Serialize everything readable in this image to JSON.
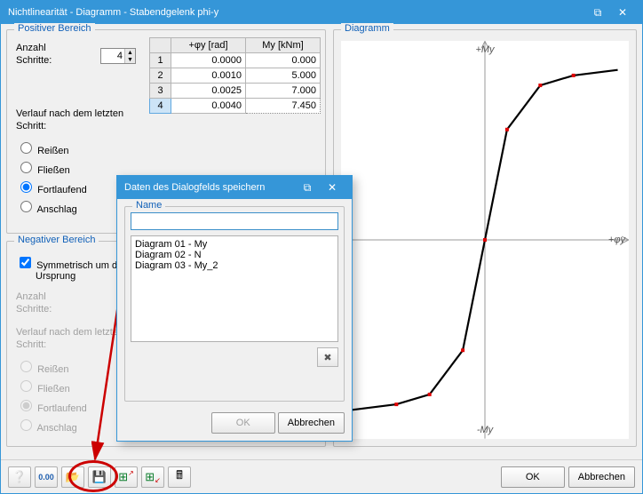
{
  "window_title": "Nichtlinearität - Diagramm - Stabendgelenk phi-y",
  "groups": {
    "positive": "Positiver Bereich",
    "negative": "Negativer Bereich",
    "diagram": "Diagramm"
  },
  "labels": {
    "anzahl": "Anzahl",
    "schritte": "Schritte:",
    "verlauf1": "Verlauf nach dem letzten",
    "verlauf2": "Schritt:",
    "sym": "Symmetrisch um den",
    "sym2": "Ursprung"
  },
  "steps_value": "4",
  "radios": {
    "r1": "Reißen",
    "r2": "Fließen",
    "r3": "Fortlaufend",
    "r4": "Anschlag"
  },
  "radio_selected": "r3",
  "table": {
    "headers": {
      "empty": "",
      "phi": "+φy [rad]",
      "m": "My [kNm]"
    },
    "rows": [
      {
        "n": "1",
        "phi": "0.0000",
        "m": "0.000"
      },
      {
        "n": "2",
        "phi": "0.0010",
        "m": "5.000"
      },
      {
        "n": "3",
        "phi": "0.0025",
        "m": "7.000"
      },
      {
        "n": "4",
        "phi": "0.0040",
        "m": "7.450"
      }
    ]
  },
  "axis": {
    "my_plus": "+My",
    "my_minus": "-My",
    "phi": "+φy"
  },
  "footer": {
    "ok": "OK",
    "cancel": "Abbrechen"
  },
  "dialog": {
    "title": "Daten des Dialogfelds speichern",
    "group": "Name",
    "items": [
      "Diagram 01 - My",
      "Diagram 02 - N",
      "Diagram 03 - My_2"
    ],
    "ok": "OK",
    "cancel": "Abbrechen"
  },
  "chart_data": {
    "type": "line",
    "x": [
      -0.006,
      -0.004,
      -0.0025,
      -0.001,
      0.0,
      0.001,
      0.0025,
      0.004,
      0.006
    ],
    "y": [
      -7.7,
      -7.45,
      -7.0,
      -5.0,
      0.0,
      5.0,
      7.0,
      7.45,
      7.7
    ],
    "xlim": [
      -0.0065,
      0.0065
    ],
    "ylim": [
      -9,
      9
    ],
    "points_x": [
      -0.004,
      -0.0025,
      -0.001,
      0.0,
      0.001,
      0.0025,
      0.004
    ],
    "points_y": [
      -7.45,
      -7.0,
      -5.0,
      0.0,
      5.0,
      7.0,
      7.45
    ]
  }
}
